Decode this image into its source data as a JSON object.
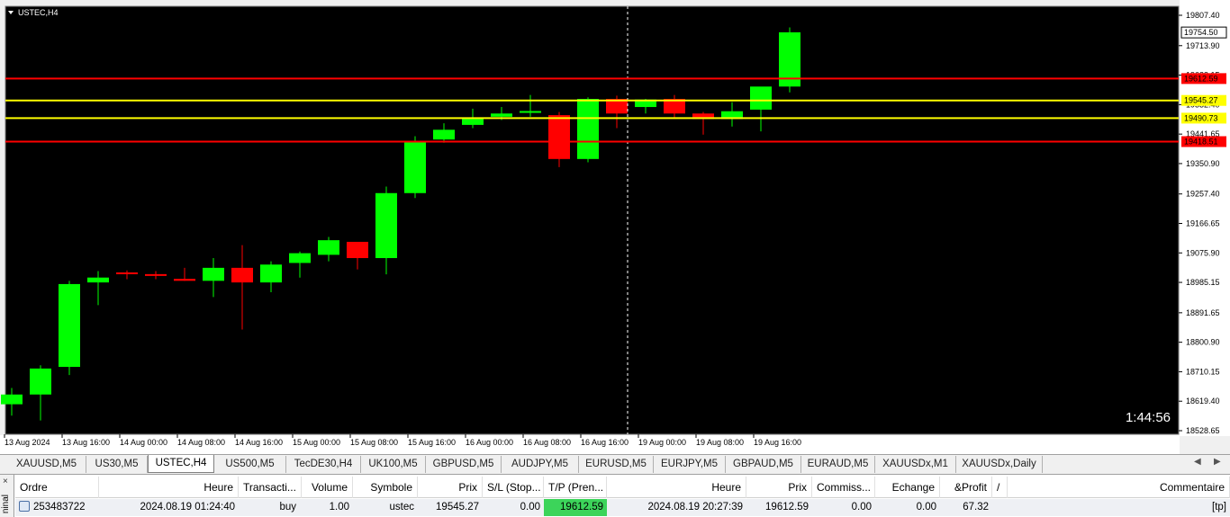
{
  "chart": {
    "symbol_label": "USTEC,H4",
    "countdown": "1:44:56",
    "price_axis": {
      "min": 18528.65,
      "max": 19807.4,
      "ticks": [
        "19807.40",
        "19713.90",
        "19623.15",
        "19532.40",
        "19441.65",
        "19350.90",
        "19257.40",
        "19166.65",
        "19075.90",
        "18985.15",
        "18891.65",
        "18800.90",
        "18710.15",
        "18619.40",
        "18528.65"
      ]
    },
    "time_labels": [
      "13 Aug 2024",
      "13 Aug 16:00",
      "14 Aug 00:00",
      "14 Aug 08:00",
      "14 Aug 16:00",
      "15 Aug 00:00",
      "15 Aug 08:00",
      "15 Aug 16:00",
      "16 Aug 00:00",
      "16 Aug 08:00",
      "16 Aug 16:00",
      "19 Aug 00:00",
      "19 Aug 08:00",
      "19 Aug 16:00"
    ],
    "current_price_label": "19754.50",
    "levels": [
      {
        "price": 19612.59,
        "label": "19612.59",
        "color": "#ff0000",
        "label_bg": "#ff0000"
      },
      {
        "price": 19545.27,
        "label": "19545.27",
        "color": "#ffff00",
        "label_bg": "#ffff00"
      },
      {
        "price": 19490.73,
        "label": "19490.73",
        "color": "#ffff00",
        "label_bg": "#ffff00"
      },
      {
        "price": 19418.51,
        "label": "19418.51",
        "color": "#ff0000",
        "label_bg": "#ff0000"
      }
    ],
    "colors": {
      "background": "#000000",
      "bull": "#00ff00",
      "bear": "#ff0000",
      "grid_crosshair": "#ffffff"
    },
    "candles": [
      {
        "o": 18610,
        "h": 18660,
        "l": 18575,
        "c": 18640
      },
      {
        "o": 18640,
        "h": 18730,
        "l": 18560,
        "c": 18720
      },
      {
        "o": 18725,
        "h": 18990,
        "l": 18700,
        "c": 18980
      },
      {
        "o": 18985,
        "h": 19020,
        "l": 18915,
        "c": 19000
      },
      {
        "o": 19013,
        "h": 19022,
        "l": 18995,
        "c": 19009
      },
      {
        "o": 19008,
        "h": 19020,
        "l": 18995,
        "c": 19006
      },
      {
        "o": 18996,
        "h": 19030,
        "l": 18990,
        "c": 18990
      },
      {
        "o": 18990,
        "h": 19060,
        "l": 18940,
        "c": 19030
      },
      {
        "o": 19030,
        "h": 19100,
        "l": 18840,
        "c": 18985
      },
      {
        "o": 18985,
        "h": 19050,
        "l": 18955,
        "c": 19040
      },
      {
        "o": 19045,
        "h": 19080,
        "l": 19000,
        "c": 19075
      },
      {
        "o": 19070,
        "h": 19125,
        "l": 19050,
        "c": 19115
      },
      {
        "o": 19110,
        "h": 19110,
        "l": 19025,
        "c": 19060
      },
      {
        "o": 19060,
        "h": 19280,
        "l": 19010,
        "c": 19260
      },
      {
        "o": 19260,
        "h": 19435,
        "l": 19245,
        "c": 19420
      },
      {
        "o": 19425,
        "h": 19475,
        "l": 19415,
        "c": 19455
      },
      {
        "o": 19470,
        "h": 19520,
        "l": 19460,
        "c": 19490
      },
      {
        "o": 19495,
        "h": 19525,
        "l": 19485,
        "c": 19505
      },
      {
        "o": 19507,
        "h": 19562,
        "l": 19495,
        "c": 19510
      },
      {
        "o": 19500,
        "h": 19510,
        "l": 19340,
        "c": 19365
      },
      {
        "o": 19365,
        "h": 19555,
        "l": 19355,
        "c": 19550
      },
      {
        "o": 19550,
        "h": 19560,
        "l": 19460,
        "c": 19505
      },
      {
        "o": 19525,
        "h": 19550,
        "l": 19505,
        "c": 19548
      },
      {
        "o": 19550,
        "h": 19562,
        "l": 19490,
        "c": 19505
      },
      {
        "o": 19505,
        "h": 19510,
        "l": 19440,
        "c": 19488
      },
      {
        "o": 19488,
        "h": 19540,
        "l": 19465,
        "c": 19512
      },
      {
        "o": 19517,
        "h": 19580,
        "l": 19450,
        "c": 19588
      },
      {
        "o": 19588,
        "h": 19770,
        "l": 19570,
        "c": 19755
      }
    ],
    "crosshair_candle_index": 21
  },
  "tabs": [
    {
      "label": "XAUUSD,M5",
      "active": false
    },
    {
      "label": "US30,M5",
      "active": false
    },
    {
      "label": "USTEC,H4",
      "active": true
    },
    {
      "label": "US500,M5",
      "active": false
    },
    {
      "label": "TecDE30,H4",
      "active": false
    },
    {
      "label": "UK100,M5",
      "active": false
    },
    {
      "label": "GBPUSD,M5",
      "active": false
    },
    {
      "label": "AUDJPY,M5",
      "active": false
    },
    {
      "label": "EURUSD,M5",
      "active": false
    },
    {
      "label": "EURJPY,M5",
      "active": false
    },
    {
      "label": "GBPAUD,M5",
      "active": false
    },
    {
      "label": "EURAUD,M5",
      "active": false
    },
    {
      "label": "XAUUSDx,M1",
      "active": false
    },
    {
      "label": "XAUUSDx,Daily",
      "active": false
    }
  ],
  "terminal": {
    "side_label": "ninal",
    "close_glyph": "×",
    "headers": [
      "Ordre",
      "Heure",
      "Transacti...",
      "Volume",
      "Symbole",
      "Prix",
      "S/L (Stop...",
      "T/P (Pren...",
      "Heure",
      "Prix",
      "Commiss...",
      "Echange",
      "&Profit",
      "/",
      "Commentaire"
    ],
    "row": {
      "order": "253483722",
      "time": "2024.08.19 01:24:40",
      "type": "buy",
      "volume": "1.00",
      "symbol": "ustec",
      "price": "19545.27",
      "sl": "0.00",
      "tp": "19612.59",
      "close_time": "2024.08.19 20:27:39",
      "close_price": "19612.59",
      "commission": "0.00",
      "swap": "0.00",
      "profit": "67.32",
      "comment": "[tp]"
    }
  }
}
